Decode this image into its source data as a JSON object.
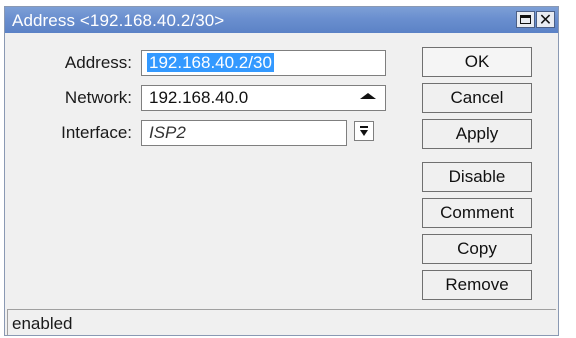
{
  "window": {
    "title": "Address <192.168.40.2/30>"
  },
  "form": {
    "address_label": "Address:",
    "address_value": "192.168.40.2/30",
    "network_label": "Network:",
    "network_value": "192.168.40.0",
    "interface_label": "Interface:",
    "interface_value": "ISP2"
  },
  "buttons": {
    "ok": "OK",
    "cancel": "Cancel",
    "apply": "Apply",
    "disable": "Disable",
    "comment": "Comment",
    "copy": "Copy",
    "remove": "Remove"
  },
  "status": {
    "text": "enabled"
  },
  "icons": {
    "maximize": "maximize-icon",
    "close": "close-icon",
    "network_expand": "arrow-up-icon",
    "interface_dropdown": "dropdown-icon"
  },
  "colors": {
    "titlebar": "#6a8fcf",
    "selection": "#3399ff"
  }
}
